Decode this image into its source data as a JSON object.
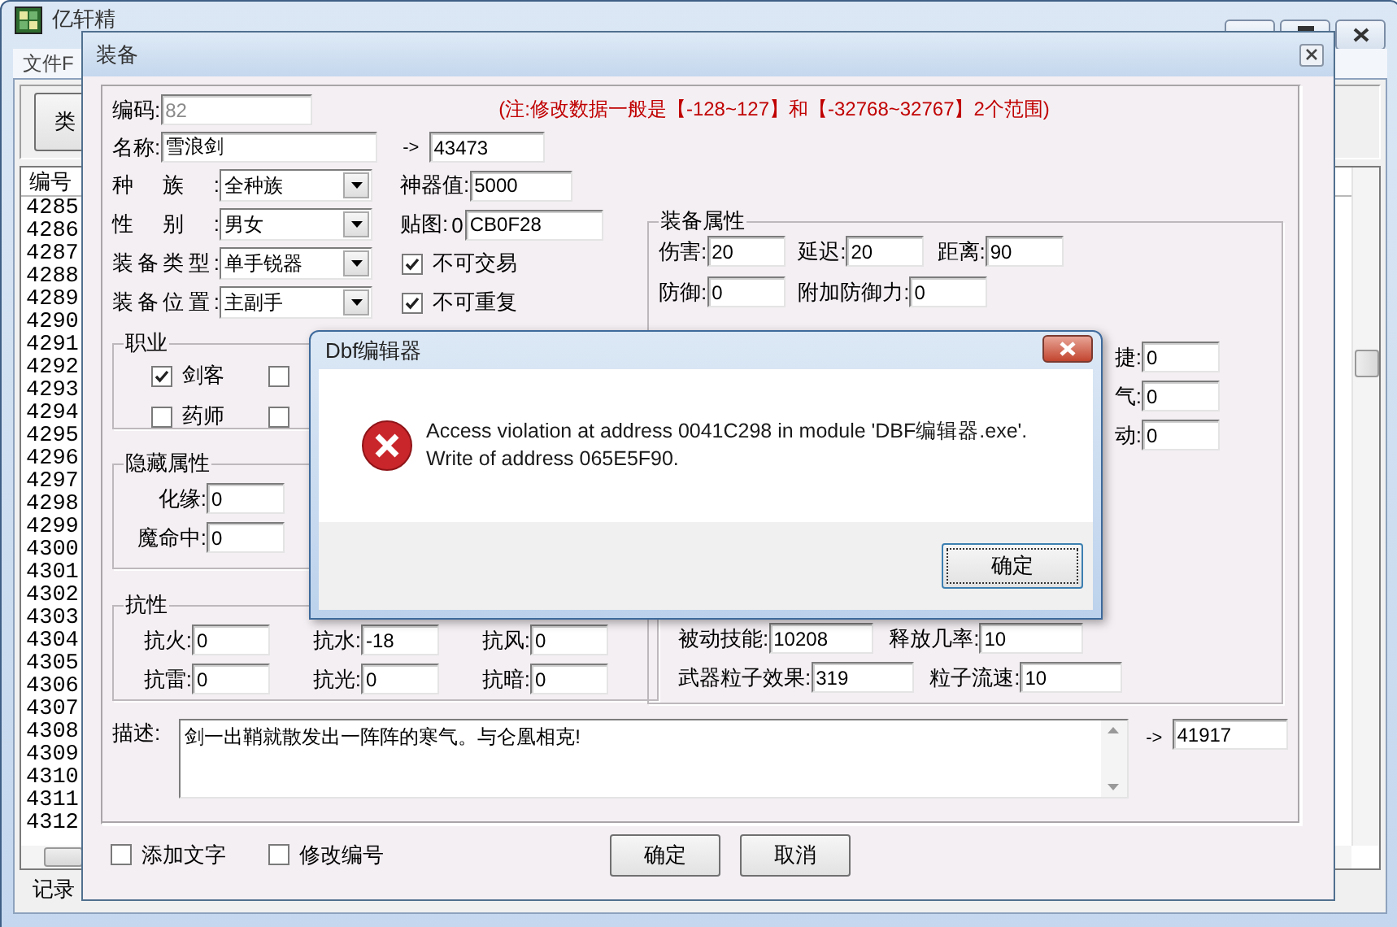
{
  "main_window": {
    "title": "亿轩精",
    "menu": [
      "文件F"
    ],
    "toolbar": {
      "button": "类"
    },
    "list": {
      "header": "编号",
      "rows": [
        "4285",
        "4286",
        "4287",
        "4288",
        "4289",
        "4290",
        "4291",
        "4292",
        "4293",
        "4294",
        "4295",
        "4296",
        "4297",
        "4298",
        "4299",
        "4300",
        "4301",
        "4302",
        "4303",
        "4304",
        "4305",
        "4306",
        "4307",
        "4308",
        "4309",
        "4310",
        "4311",
        "4312"
      ]
    },
    "status_bar": "记录"
  },
  "equip_dialog": {
    "title": "装备",
    "code": {
      "label": "编码:",
      "value": "82",
      "disabled": true
    },
    "note": "(注:修改数据一般是【-128~127】和【-32768~32767】2个范围)",
    "name": {
      "label": "名称:",
      "value": "雪浪剑",
      "arrow": "->",
      "id": "43473"
    },
    "selects": [
      {
        "label": "种族:",
        "value": "全种族"
      },
      {
        "label": "性别:",
        "value": "男女"
      },
      {
        "label": "装备类型:",
        "value": "单手锐器"
      },
      {
        "label": "装备位置:",
        "value": "主副手"
      }
    ],
    "side": [
      {
        "kind": "field",
        "label": "神器值:",
        "value": "5000"
      },
      {
        "kind": "field",
        "label": "贴图:",
        "prefix": "0",
        "value": "CB0F28"
      },
      {
        "kind": "checkbox",
        "label": "不可交易",
        "checked": true
      },
      {
        "kind": "checkbox",
        "label": "不可重复",
        "checked": true
      }
    ],
    "professions": {
      "title": "职业",
      "items": [
        {
          "label": "剑客",
          "checked": true
        },
        {
          "checked": false
        },
        {
          "label": "药师",
          "checked": false
        },
        {
          "checked": false
        }
      ]
    },
    "hidden_attributes": {
      "title": "隐藏属性",
      "fields": [
        {
          "label": "化缘:",
          "value": "0"
        },
        {
          "label": "魔命中:",
          "value": "0"
        }
      ]
    },
    "resistances": {
      "title": "抗性",
      "fields": [
        {
          "label": "抗火:",
          "value": "0"
        },
        {
          "label": "抗水:",
          "value": "-18"
        },
        {
          "label": "抗风:",
          "value": "0"
        },
        {
          "label": "抗雷:",
          "value": "0"
        },
        {
          "label": "抗光:",
          "value": "0"
        },
        {
          "label": "抗暗:",
          "value": "0"
        }
      ]
    },
    "attributes": {
      "title": "装备属性",
      "rows": [
        [
          {
            "label": "伤害:",
            "value": "20"
          },
          {
            "label": "延迟:",
            "value": "20"
          },
          {
            "label": "距离:",
            "value": "90"
          }
        ],
        [
          {
            "label": "防御:",
            "value": "0"
          },
          {
            "label": "附加防御力:",
            "value": "0"
          }
        ]
      ],
      "side_fields": [
        {
          "label": "捷:",
          "value": "0"
        },
        {
          "label": "气:",
          "value": "0"
        },
        {
          "label": "动:",
          "value": "0"
        }
      ],
      "skill_rows": [
        [
          {
            "label": "被动技能:",
            "value": "10208"
          },
          {
            "label": "释放几率:",
            "value": "10"
          }
        ],
        [
          {
            "label": "武器粒子效果:",
            "value": "319"
          },
          {
            "label": "粒子流速:",
            "value": "10"
          }
        ]
      ]
    },
    "description": {
      "label": "描述:",
      "value": "剑一出鞘就散发出一阵阵的寒气。与仑凰相克!",
      "arrow": "->",
      "id": "41917"
    },
    "options": [
      {
        "label": "添加文字",
        "checked": false
      },
      {
        "label": "修改编号",
        "checked": false
      }
    ],
    "buttons": [
      "确定",
      "取消"
    ]
  },
  "error_dialog": {
    "title": "Dbf编辑器",
    "message": [
      "Access violation at address 0041C298 in module 'DBF编辑器.exe'.",
      "Write of address 065E5F90."
    ],
    "button": "确定"
  }
}
